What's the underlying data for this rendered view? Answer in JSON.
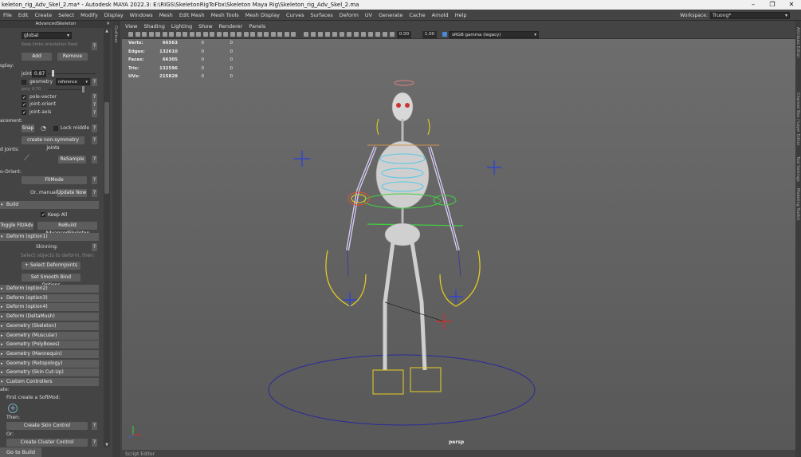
{
  "window": {
    "title": "keleton_rig_Adv_Skel_2.ma* - Autodesk MAYA 2022.3: E:\\RIGS\\SkeletonRigToFbx\\Skeleton Maya Rig\\Skeleton_rig_Adv_Skel_2.ma",
    "controls": [
      "–",
      "❐",
      "✕"
    ]
  },
  "menubar": {
    "items": [
      "File",
      "Edit",
      "Create",
      "Select",
      "Modify",
      "Display",
      "Windows",
      "Mesh",
      "Edit Mesh",
      "Mesh Tools",
      "Mesh Display",
      "Curves",
      "Surfaces",
      "Deform",
      "UV",
      "Generate",
      "Cache",
      "Arnold",
      "Help"
    ],
    "workspace_label": "Workspace:",
    "workspace_value": "Truong*"
  },
  "panel": {
    "title": "AdvancedSkeleton",
    "global_dropdown": "global",
    "keep_limbs": "Keep limbs orientation fixed",
    "add": "Add",
    "remove": "Remove",
    "display_label": "splay:",
    "joint_label": "joint",
    "joint_value": "0.87",
    "geometry_label": "geometry",
    "geometry_mode": "reference",
    "poly_label": "poly",
    "poly_value": "0.70",
    "pole_vector": "pole-vector",
    "joint_orient": "joint-orient",
    "joint_axis": "joint-axis",
    "placement_label": "acement:",
    "snap": "Snap",
    "lock_middle": "Lock middle",
    "create_non_sym": "create non-symmetry joints",
    "curved_joints_label": "d Joints:",
    "resample": "ReSample",
    "auto_orient_label": "o-Orient:",
    "fitmode": "FitMode",
    "or_manual": "Or, manual:",
    "update_now": "Update Now",
    "build": "Build",
    "keep_all": "Keep All",
    "toggle_fit": "Toggle Fit/Adv",
    "rebuild": "ReBuild AdvancedSkeleton",
    "deform1": "Deform    (option1)",
    "skinning": "Skinning:",
    "select_objects": "Select objects to deform, then:",
    "select_deform_joints": "+ Select DeformJoints",
    "set_smooth_bind": "Set Smooth Bind Options",
    "sections": [
      "Deform    (option2)",
      "Deform    (option3)",
      "Deform    (option4)",
      "Deform    (DeltaMush)",
      "Geometry (Skeleton)",
      "Geometry (Muscular)",
      "Geometry (PolyBoxes)",
      "Geometry (Mannequin)",
      "Geometry (Retopology)",
      "Geometry (Skin Cut-Up)"
    ],
    "custom_controllers": "Custom Controllers",
    "create_label": "ate:",
    "first_softmod": "First create a SoftMod:",
    "then": "Then:",
    "create_skin_control": "Create Skin Control",
    "or": "Or:",
    "create_cluster_control": "Create Cluster Control",
    "go_to_build_pose": "Go to Build Pose",
    "help_mark": "?"
  },
  "outliner": {
    "label": "Outliner"
  },
  "viewport": {
    "menu": [
      "View",
      "Shading",
      "Lighting",
      "Show",
      "Renderer",
      "Panels"
    ],
    "toolbar": {
      "value_a": "0.00",
      "value_b": "1.00",
      "color_space": "sRGB gamma (legacy)"
    },
    "hud": [
      {
        "label": "Verts:",
        "v1": "66563",
        "v2": "0",
        "v3": "0"
      },
      {
        "label": "Edges:",
        "v1": "132610",
        "v2": "0",
        "v3": "0"
      },
      {
        "label": "Faces:",
        "v1": "66305",
        "v2": "0",
        "v3": "0"
      },
      {
        "label": "Tris:",
        "v1": "132596",
        "v2": "0",
        "v3": "0"
      },
      {
        "label": "UVs:",
        "v1": "215828",
        "v2": "0",
        "v3": "0"
      }
    ],
    "camera": "persp"
  },
  "right_tabs": [
    "Attribute Editor",
    "Channel Box / Layer Editor",
    "Tool Settings",
    "Modeling Toolkit"
  ],
  "status": {
    "script_editor": "Script Editor"
  },
  "colors": {
    "bg": "#444444",
    "button": "#5d5d5d",
    "field": "#2b2b2b",
    "viewport_top": "#6d6d6d",
    "viewport_bottom": "#585858"
  }
}
